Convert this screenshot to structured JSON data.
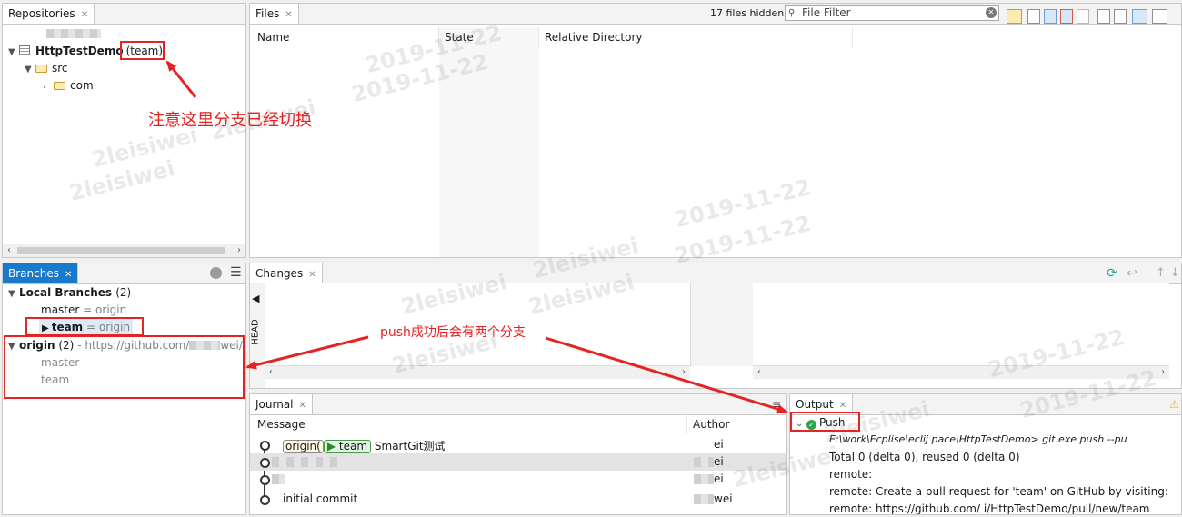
{
  "repositories": {
    "tab_label": "Repositories",
    "repo_name": "HttpTestDemo",
    "repo_branch": "(team)",
    "tree": [
      {
        "label": "src"
      },
      {
        "label": "com"
      }
    ]
  },
  "files": {
    "tab_label": "Files",
    "hidden_count": "17 files hidden",
    "filter_placeholder": "File Filter",
    "columns": [
      "Name",
      "State",
      "Relative Directory"
    ]
  },
  "branches": {
    "tab_label": "Branches",
    "local_header": "Local Branches",
    "local_count": "(2)",
    "local": [
      {
        "name": "master",
        "sep": "=",
        "tracking": "origin"
      },
      {
        "name": "team",
        "sep": "=",
        "tracking": "origin"
      }
    ],
    "remote_name": "origin",
    "remote_count": "(2)",
    "remote_url_start": "- https://github.com/",
    "remote_url_end": "wei/Http",
    "remote": [
      "master",
      "team"
    ]
  },
  "changes": {
    "tab_label": "Changes",
    "head_label": "HEAD"
  },
  "journal": {
    "tab_label": "Journal",
    "columns": [
      "Message",
      "Author"
    ],
    "first_labels": {
      "origin": "origin(",
      "team": "team"
    },
    "rows": [
      {
        "message": "SmartGit测试",
        "author": "ei"
      },
      {
        "message": "",
        "author": "ei"
      },
      {
        "message": "",
        "author": "ei"
      },
      {
        "message": "initial commit",
        "author": "wei"
      }
    ]
  },
  "output": {
    "tab_label": "Output",
    "push_label": "Push",
    "lines": [
      "E:\\work\\Ecplise\\eclij            pace\\HttpTestDemo> git.exe push --pu",
      "Total 0 (delta 0), reused 0 (delta 0)",
      "remote:",
      "remote: Create a pull request for 'team' on GitHub by visiting:",
      "remote:      https://github.com/          i/HttpTestDemo/pull/new/team"
    ]
  },
  "annotations": {
    "branch_switched": "注意这里分支已经切换",
    "two_branches": "push成功后会有两个分支"
  },
  "watermark": {
    "date": "2019-11-22",
    "user": "2leisiwei"
  },
  "colors": {
    "accent": "#1979ca",
    "annotation_red": "#e52323",
    "success_green": "#2da44e"
  }
}
